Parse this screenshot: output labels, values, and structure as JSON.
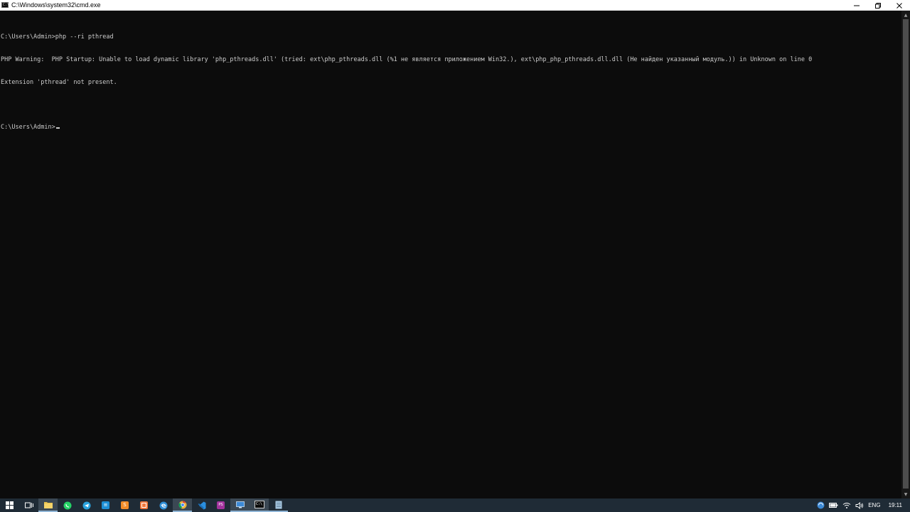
{
  "window": {
    "title": "C:\\Windows\\system32\\cmd.exe",
    "icon_glyph": "C:\\"
  },
  "controls": {
    "minimize": "minimize-icon",
    "restore": "restore-icon",
    "close": "close-icon"
  },
  "console": {
    "lines": [
      "C:\\Users\\Admin>php --ri pthread",
      "PHP Warning:  PHP Startup: Unable to load dynamic library 'php_pthreads.dll' (tried: ext\\php_pthreads.dll (%1 не является приложением Win32.), ext\\php_php_pthreads.dll.dll (Не найден указанный модуль.)) in Unknown on line 0",
      "Extension 'pthread' not present.",
      "",
      "C:\\Users\\Admin>"
    ],
    "text_color": "#cccccc",
    "background": "#0c0c0c"
  },
  "taskbar": {
    "background": "#1f2b36",
    "apps": [
      {
        "name": "windows-start-icon",
        "color": "#ffffff",
        "glyph": ""
      },
      {
        "name": "task-view-icon",
        "color": "#ffffff",
        "glyph": ""
      },
      {
        "name": "file-explorer-icon",
        "color": "#e8c14a",
        "glyph": ""
      },
      {
        "name": "whatsapp-icon",
        "color": "#25d366",
        "glyph": ""
      },
      {
        "name": "telegram-icon",
        "color": "#2aa3df",
        "glyph": ""
      },
      {
        "name": "tasks-app-icon",
        "color": "#1e8fd6",
        "glyph": "≡"
      },
      {
        "name": "sublime-text-icon",
        "color": "#f28c28",
        "glyph": "S"
      },
      {
        "name": "notes-app-icon",
        "color": "#f1783c",
        "glyph": ""
      },
      {
        "name": "edge-icon",
        "color": "#2f8fd8",
        "glyph": "e"
      },
      {
        "name": "chrome-icon",
        "color": "#e8b23a",
        "glyph": ""
      },
      {
        "name": "vscode-icon",
        "color": "#2a8fe0",
        "glyph": ""
      },
      {
        "name": "phpstorm-icon",
        "color": "#a3339d",
        "glyph": "PS"
      },
      {
        "name": "remote-desktop-icon",
        "color": "#3d8ad6",
        "glyph": ""
      },
      {
        "name": "cmd-icon",
        "color": "#0c0c0c",
        "glyph": "C:\\"
      },
      {
        "name": "notepad-icon",
        "color": "#a7c7e0",
        "glyph": ""
      }
    ],
    "tray": {
      "lang": "ENG",
      "time": "19:11"
    }
  }
}
